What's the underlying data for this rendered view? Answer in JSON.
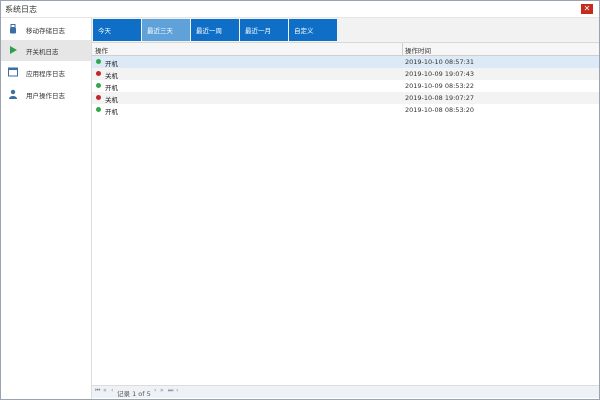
{
  "window": {
    "title": "系统日志",
    "close_glyph": "✕"
  },
  "sidebar": {
    "items": [
      {
        "label": "移动存储日志",
        "icon": "usb-icon"
      },
      {
        "label": "开关机日志",
        "icon": "play-icon",
        "active": true
      },
      {
        "label": "应用程序日志",
        "icon": "application-window-icon"
      },
      {
        "label": "用户操作日志",
        "icon": "user-icon"
      }
    ]
  },
  "tabs": [
    {
      "label": "今天"
    },
    {
      "label": "最近三天",
      "active": true
    },
    {
      "label": "最近一周"
    },
    {
      "label": "最近一月"
    },
    {
      "label": "自定义"
    }
  ],
  "table": {
    "columns": [
      "操作",
      "操作时间"
    ],
    "rows": [
      {
        "op": "开机",
        "time": "2019-10-10 08:57:31",
        "status": "on"
      },
      {
        "op": "关机",
        "time": "2019-10-09 19:07:43",
        "status": "off"
      },
      {
        "op": "开机",
        "time": "2019-10-09 08:53:22",
        "status": "on"
      },
      {
        "op": "关机",
        "time": "2019-10-08 19:07:27",
        "status": "off"
      },
      {
        "op": "开机",
        "time": "2019-10-08 08:53:20",
        "status": "on"
      }
    ]
  },
  "pager": {
    "text": "记录 1 of 5",
    "first": "⏮",
    "prev_page": "«",
    "prev": "‹",
    "next": "›",
    "next_page": "»",
    "last": "⏭",
    "extra": "‹"
  },
  "colors": {
    "accent": "#0f6fc6",
    "accent_active": "#5ea2d9",
    "on": "#2ea84a",
    "off": "#c0262c",
    "selected_row": "#dce9f6"
  }
}
